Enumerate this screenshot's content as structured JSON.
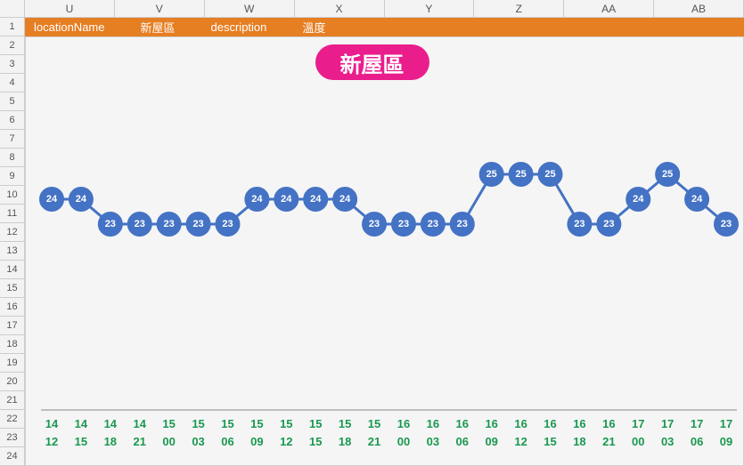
{
  "columns": [
    "U",
    "V",
    "W",
    "X",
    "Y",
    "Z",
    "AA",
    "AB"
  ],
  "rows": [
    "1",
    "2",
    "3",
    "4",
    "5",
    "6",
    "7",
    "8",
    "9",
    "10",
    "11",
    "12",
    "13",
    "14",
    "15",
    "16",
    "17",
    "18",
    "19",
    "20",
    "21",
    "22",
    "23",
    "24"
  ],
  "header": {
    "k1": "locationName",
    "v1": "新屋區",
    "k2": "description",
    "v2": "溫度"
  },
  "title": "新屋區",
  "chart_data": {
    "type": "line",
    "title": "新屋區",
    "ylabel": "溫度",
    "series": [
      {
        "name": "溫度",
        "values": [
          24,
          24,
          23,
          23,
          23,
          23,
          23,
          24,
          24,
          24,
          24,
          23,
          23,
          23,
          23,
          25,
          25,
          25,
          23,
          23,
          24,
          25,
          24,
          23
        ]
      }
    ],
    "x_top": [
      "14",
      "14",
      "14",
      "14",
      "15",
      "15",
      "15",
      "15",
      "15",
      "15",
      "15",
      "15",
      "16",
      "16",
      "16",
      "16",
      "16",
      "16",
      "16",
      "16",
      "17",
      "17",
      "17",
      "17"
    ],
    "x_bot": [
      "12",
      "15",
      "18",
      "21",
      "00",
      "03",
      "06",
      "09",
      "12",
      "15",
      "18",
      "21",
      "00",
      "03",
      "06",
      "09",
      "12",
      "15",
      "18",
      "21",
      "00",
      "03",
      "06",
      "09"
    ]
  }
}
